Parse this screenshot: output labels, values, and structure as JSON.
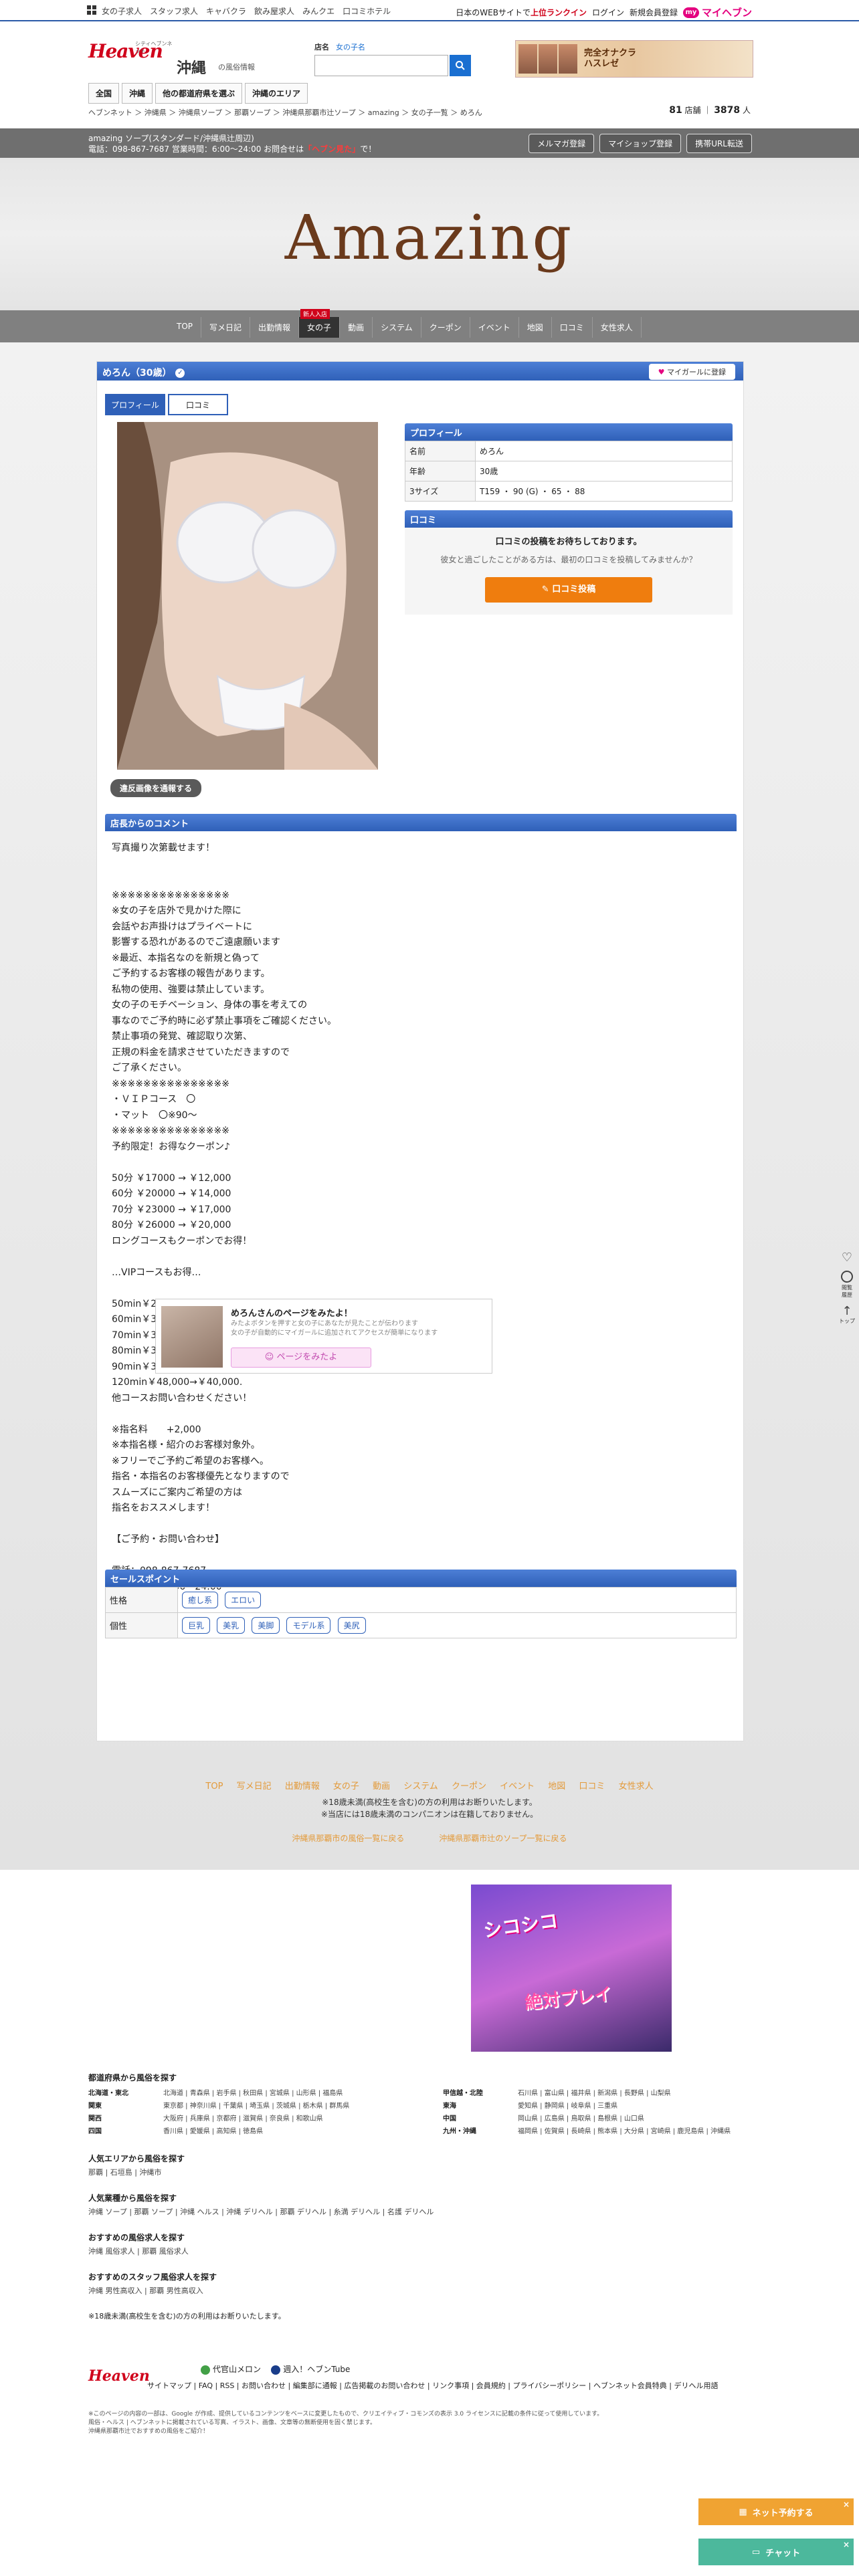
{
  "topbar": {
    "nav": [
      "女の子求人",
      "スタッフ求人",
      "キャバクラ",
      "飲み屋求人",
      "みんクエ",
      "口コミホテル"
    ],
    "promo_prefix": "日本のWEBサイトで",
    "promo_highlight": "上位ランクイン",
    "login": "ログイン",
    "register": "新規会員登録",
    "my_badge": "my",
    "myheaven": "マイヘブン"
  },
  "header": {
    "logo": "Heaven",
    "logo_sub": "シティヘブンネット",
    "region": "沖縄",
    "region_sub": "の風俗情報",
    "tabs": [
      "全国",
      "沖縄",
      "他の都道府県を選ぶ",
      "沖縄のエリア"
    ],
    "search": {
      "label_shop": "店名",
      "label_girl": "女の子名",
      "placeholder": ""
    },
    "banner_text": "完全オナクラ\nハスレゼ",
    "breadcrumb": "ヘブンネット ＞ 沖縄県 ＞ 沖縄県ソープ ＞ 那覇ソープ ＞ 沖縄県那覇市辻ソープ ＞ amazing ＞ 女の子一覧 ＞ めろん",
    "count1": "81",
    "count1_unit": "店舗",
    "count2": "3878",
    "count2_unit": "人"
  },
  "shopbar": {
    "name": "amazing ソープ(スタンダード/沖縄県辻周辺)",
    "tel": "電話：098-867-7687 営業時間：6:00〜24:00 お問合せは",
    "tel_red": "「ヘブン見た」",
    "tel_tail": "で！",
    "buttons": [
      "メルマガ登録",
      "マイショップ登録",
      "携帯URL転送"
    ]
  },
  "hero": {
    "title": "Amazing"
  },
  "sitenav": {
    "items": [
      "TOP",
      "写メ日記",
      "出勤情報",
      "女の子",
      "動画",
      "システム",
      "クーポン",
      "イベント",
      "地図",
      "口コミ",
      "女性求人"
    ],
    "new_badge": "新人入店"
  },
  "girl": {
    "name": "めろん（30歳）",
    "verified": "✓",
    "fav_button": "マイガールに登録",
    "tabs": [
      "プロフィール",
      "口コミ"
    ],
    "report_button": "違反画像を通報する",
    "profile_title": "プロフィール",
    "profile": [
      {
        "k": "名前",
        "v": "めろん"
      },
      {
        "k": "年齢",
        "v": "30歳"
      },
      {
        "k": "3サイズ",
        "v": "T159 ・ 90 (G) ・ 65 ・ 88"
      }
    ],
    "kuchikomi_title": "口コミ",
    "kuchikomi_l1": "口コミの投稿をお待ちしております。",
    "kuchikomi_l2": "彼女と過ごしたことがある方は、最初の口コミを投稿してみませんか？",
    "kuchikomi_button": "口コミ投稿",
    "comment_title": "店長からのコメント",
    "comment": "写真撮り次第載せます！\n\n\n※※※※※※※※※※※※※※※\n※女の子を店外で見かけた際に\n会話やお声掛けはプライベートに\n影響する恐れがあるのでご遠慮願います\n※最近、本指名なのを新規と偽って\nご予約するお客様の報告があります。\n私物の使用、強要は禁止しています。\n女の子のモチベーション、身体の事を考えての\n事なのでご予約時に必ず禁止事項をご確認ください。\n禁止事項の発覚、確認取り次第、\n正規の料金を請求させていただきますので\nご了承ください。\n※※※※※※※※※※※※※※※\n・ＶＩＰコース　〇\n・マット　〇※90〜\n※※※※※※※※※※※※※※※\n予約限定！お得なクーポン♪\n\n50分 ￥17000 → ￥12,000\n60分 ￥20000 → ￥14,000\n70分 ￥23000 → ￥17,000\n80分 ￥26000 → ￥20,000\nロングコースもクーポンでお得！\n\n…VIPコースもお得…\n\n50min￥27,000→￥18,000.\n60min￥30,000→￥21,000.\n70min￥33,000→￥24,000.\n80min￥36,000→￥27,000.\n90min￥39,000→￥30,000.\n120min￥48,000→￥40,000.\n他コースお問い合わせください！\n\n※指名料　　+2,000\n※本指名様・紹介のお客様対象外。\n※フリーでご予約ご希望のお客様へ。\n指名・本指名のお客様優先となりますので\nスムーズにご案内ご希望の方は\n指名をおススメします！\n\n【ご予約・お問い合わせ】\n\n電話：098-867-7687\n営業時間：10:00〜24:00",
    "sales_title": "セールスポイント",
    "sales": [
      {
        "k": "性格",
        "chips": [
          "癒し系",
          "エロい"
        ]
      },
      {
        "k": "個性",
        "chips": [
          "巨乳",
          "美乳",
          "美脚",
          "モデル系",
          "美尻"
        ]
      }
    ],
    "promo_t1": "めろんさんのページをみたよ！",
    "promo_t2": "みたよボタンを押すと女の子にあなたが見たことが伝わります\n女の子が自動的にマイガールに追加されてアクセスが簡単になります",
    "promo_button": "ページをみたよ"
  },
  "footer": {
    "nav": [
      "TOP",
      "写メ日記",
      "出勤情報",
      "女の子",
      "動画",
      "システム",
      "クーポン",
      "イベント",
      "地図",
      "口コミ",
      "女性求人"
    ],
    "note1": "※18歳未満(高校生を含む)の方の利用はお断りいたします。",
    "note2": "※当店には18歳未満のコンパニオンは在籍しておりません。",
    "link1": "沖縄県那覇市の風俗一覧に戻る",
    "link2": "沖縄県那覇市辻のソープ一覧に戻る",
    "ad_text1": "シコシコ",
    "ad_text2": "絶対プレイ",
    "area_title": "都道府県から風俗を探す",
    "areas_left": [
      {
        "k": "北海道・東北",
        "v": "北海道 | 青森県 | 岩手県 | 秋田県 | 宮城県 | 山形県 | 福島県"
      },
      {
        "k": "関東",
        "v": "東京都 | 神奈川県 | 千葉県 | 埼玉県 | 茨城県 | 栃木県 | 群馬県"
      },
      {
        "k": "関西",
        "v": "大阪府 | 兵庫県 | 京都府 | 滋賀県 | 奈良県 | 和歌山県"
      },
      {
        "k": "四国",
        "v": "香川県 | 愛媛県 | 高知県 | 徳島県"
      }
    ],
    "areas_right": [
      {
        "k": "甲信越・北陸",
        "v": "石川県 | 富山県 | 福井県 | 新潟県 | 長野県 | 山梨県"
      },
      {
        "k": "東海",
        "v": "愛知県 | 静岡県 | 岐阜県 | 三重県"
      },
      {
        "k": "中国",
        "v": "岡山県 | 広島県 | 鳥取県 | 島根県 | 山口県"
      },
      {
        "k": "九州・沖縄",
        "v": "福岡県 | 佐賀県 | 長崎県 | 熊本県 | 大分県 | 宮崎県 | 鹿児島県 | 沖縄県"
      }
    ],
    "blocks": [
      {
        "t": "人気エリアから風俗を探す",
        "v": "那覇 | 石垣島 | 沖縄市"
      },
      {
        "t": "人気業種から風俗を探す",
        "v": "沖縄 ソープ | 那覇 ソープ | 沖縄 ヘルス | 沖縄 デリヘル | 那覇 デリヘル | 糸満 デリヘル | 名護 デリヘル"
      },
      {
        "t": "おすすめの風俗求人を探す",
        "v": "沖縄 風俗求人 | 那覇 風俗求人"
      },
      {
        "t": "おすすめのスタッフ風俗求人を探す",
        "v": "沖縄 男性高収入 | 那覇 男性高収入"
      }
    ],
    "age_note": "※18歳未満(高校生を含む)の方の利用はお断りいたします。",
    "bottom_logo": "Heaven",
    "sister1": "代官山メロン",
    "sister2": "週入！ヘブンTube",
    "links": "サイトマップ | FAQ | RSS | お問い合わせ | 編集部に通報 | 広告掲載のお問い合わせ | リンク事項 | 会員規約 | プライバシーポリシー | ヘブンネット会員特典 | デリヘル用語",
    "small1": "※このページの内容の一部は、Google が作成、提供しているコンテンツをベースに変更したもので、クリエイティブ・コモンズの表示 3.0 ライセンスに記載の条件に従って使用しています。",
    "small2": "風俗・ヘルス | ヘブンネットに掲載されている写真、イラスト、画像、文章等の無断使用を固く禁じます。",
    "small3": "沖縄県那覇市辻でおすすめの風俗をご紹介！"
  },
  "side": {
    "label1": "閲覧",
    "label2": "履歴",
    "label3": "トップ"
  },
  "floating": {
    "net_reserve": "ネット予約する",
    "chat": "チャット"
  }
}
